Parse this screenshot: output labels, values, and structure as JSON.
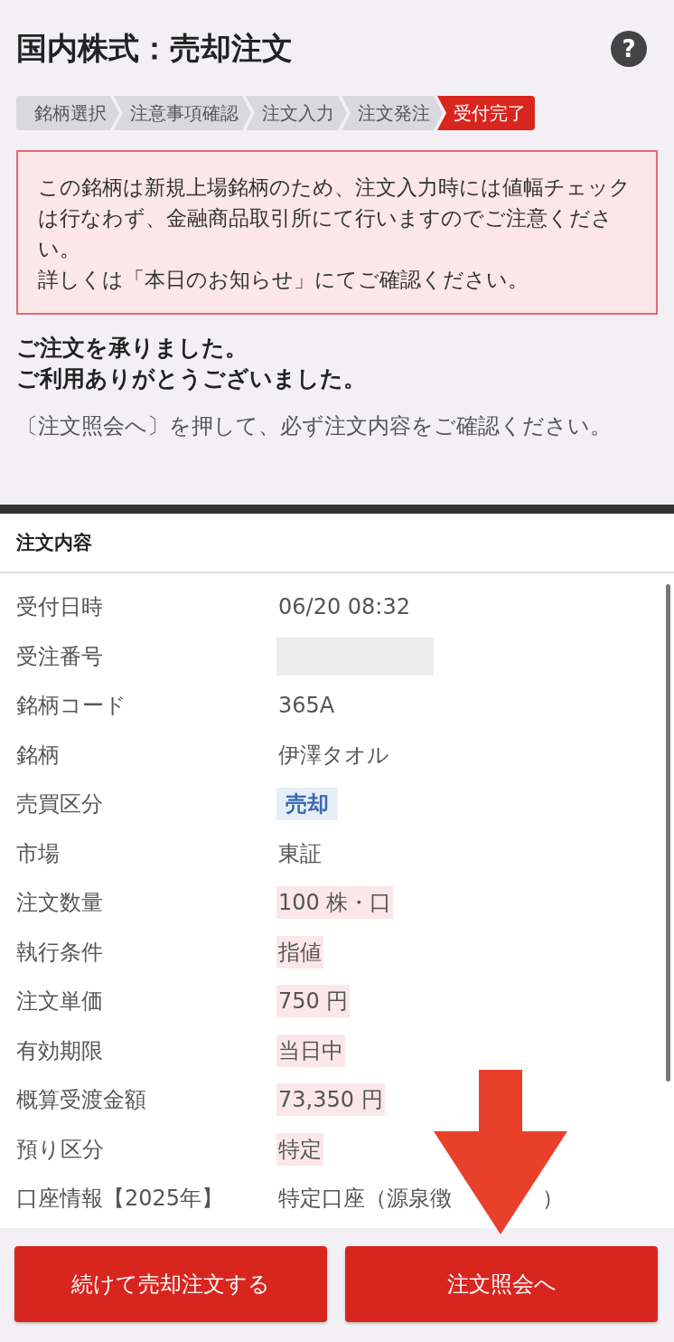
{
  "header": {
    "title": "国内株式：売却注文",
    "help": "?"
  },
  "steps": [
    {
      "label": "銘柄選択",
      "selected": false
    },
    {
      "label": "注意事項確認",
      "selected": false
    },
    {
      "label": "注文入力",
      "selected": false
    },
    {
      "label": "注文発注",
      "selected": false
    },
    {
      "label": "受付完了",
      "selected": true
    }
  ],
  "notice": [
    "この銘柄は新規上場銘柄のため、注文入力時には値幅チェックは行なわず、金融商品取引所にて行いますのでご注意ください。",
    "詳しくは「本日のお知らせ」にてご確認ください。"
  ],
  "confirmation": [
    "ご注文を承りました。",
    "ご利用ありがとうございました。"
  ],
  "instruction": "〔注文照会へ〕を押して、必ず注文内容をご確認ください。",
  "order": {
    "title": "注文内容",
    "rows": [
      {
        "label": "受付日時",
        "kind": "plain",
        "value": "06/20 08:32"
      },
      {
        "label": "受注番号",
        "kind": "redacted"
      },
      {
        "label": "銘柄コード",
        "kind": "plain",
        "value": "365A"
      },
      {
        "label": "銘柄",
        "kind": "plain",
        "value": "伊澤タオル"
      },
      {
        "label": "売買区分",
        "kind": "tag",
        "value": "売却"
      },
      {
        "label": "市場",
        "kind": "plain",
        "value": "東証"
      },
      {
        "label": "注文数量",
        "kind": "highlight",
        "value": "100 株・口"
      },
      {
        "label": "執行条件",
        "kind": "highlight",
        "value": "指値"
      },
      {
        "label": "注文単価",
        "kind": "highlight",
        "value": "750 円"
      },
      {
        "label": "有効期限",
        "kind": "highlight",
        "value": "当日中"
      },
      {
        "label": "概算受渡金額",
        "kind": "highlight",
        "value": "73,350 円"
      },
      {
        "label": "預り区分",
        "kind": "highlight",
        "value": "特定"
      },
      {
        "label": "口座情報【2025年】",
        "kind": "covered",
        "value": "特定口座（源泉徴",
        "value_end": "）"
      }
    ]
  },
  "buttons": [
    "続けて売却注文する",
    "注文照会へ"
  ]
}
